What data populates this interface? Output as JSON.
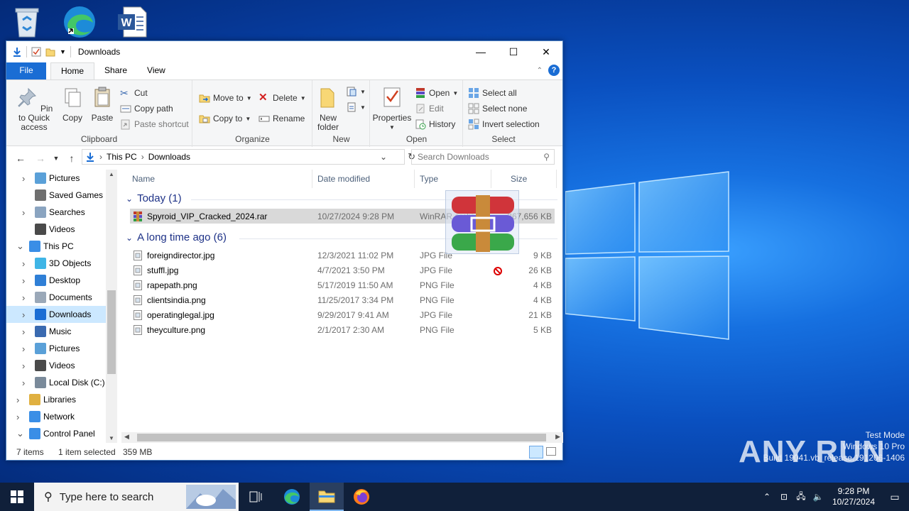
{
  "window": {
    "title": "Downloads",
    "tabs": {
      "file": "File",
      "home": "Home",
      "share": "Share",
      "view": "View"
    }
  },
  "ribbon": {
    "clipboard": {
      "label": "Clipboard",
      "pin": "Pin to Quick access",
      "copy": "Copy",
      "paste": "Paste",
      "cut": "Cut",
      "copy_path": "Copy path",
      "paste_shortcut": "Paste shortcut"
    },
    "organize": {
      "label": "Organize",
      "move_to": "Move to",
      "copy_to": "Copy to",
      "delete": "Delete",
      "rename": "Rename"
    },
    "new": {
      "label": "New",
      "new_folder": "New folder"
    },
    "open": {
      "label": "Open",
      "properties": "Properties",
      "open": "Open",
      "edit": "Edit",
      "history": "History"
    },
    "select": {
      "label": "Select",
      "select_all": "Select all",
      "select_none": "Select none",
      "invert": "Invert selection"
    }
  },
  "address": {
    "crumbs": [
      "This PC",
      "Downloads"
    ],
    "search_placeholder": "Search Downloads"
  },
  "nav": [
    {
      "label": "Pictures",
      "icon": "pictures-icon",
      "level": 1,
      "arrow": ">"
    },
    {
      "label": "Saved Games",
      "icon": "saved-games-icon",
      "level": 1,
      "arrow": ""
    },
    {
      "label": "Searches",
      "icon": "search-folder-icon",
      "level": 1,
      "arrow": ">"
    },
    {
      "label": "Videos",
      "icon": "videos-icon",
      "level": 1,
      "arrow": ""
    },
    {
      "label": "This PC",
      "icon": "this-pc-icon",
      "level": 0,
      "arrow": "v"
    },
    {
      "label": "3D Objects",
      "icon": "3d-objects-icon",
      "level": 1,
      "arrow": ">"
    },
    {
      "label": "Desktop",
      "icon": "desktop-folder-icon",
      "level": 1,
      "arrow": ">"
    },
    {
      "label": "Documents",
      "icon": "documents-icon",
      "level": 1,
      "arrow": ">"
    },
    {
      "label": "Downloads",
      "icon": "downloads-icon",
      "level": 1,
      "arrow": ">",
      "selected": true
    },
    {
      "label": "Music",
      "icon": "music-icon",
      "level": 1,
      "arrow": ">"
    },
    {
      "label": "Pictures",
      "icon": "pictures-icon",
      "level": 1,
      "arrow": ">"
    },
    {
      "label": "Videos",
      "icon": "videos-icon",
      "level": 1,
      "arrow": ">"
    },
    {
      "label": "Local Disk (C:)",
      "icon": "local-disk-icon",
      "level": 1,
      "arrow": ">"
    },
    {
      "label": "Libraries",
      "icon": "libraries-icon",
      "level": 0,
      "arrow": ">"
    },
    {
      "label": "Network",
      "icon": "network-icon",
      "level": 0,
      "arrow": ">"
    },
    {
      "label": "Control Panel",
      "icon": "control-panel-icon",
      "level": 0,
      "arrow": "v"
    }
  ],
  "columns": {
    "name": "Name",
    "date": "Date modified",
    "type": "Type",
    "size": "Size"
  },
  "groups": [
    {
      "title": "Today (1)",
      "files": [
        {
          "name": "Spyroid_VIP_Cracked_2024.rar",
          "date": "10/27/2024 9:28 PM",
          "type": "WinRAR archive",
          "size": "367,656 KB",
          "selected": true
        }
      ]
    },
    {
      "title": "A long time ago (6)",
      "files": [
        {
          "name": "foreigndirector.jpg",
          "date": "12/3/2021 11:02 PM",
          "type": "JPG File",
          "size": "9 KB"
        },
        {
          "name": "stuffl.jpg",
          "date": "4/7/2021 3:50 PM",
          "type": "JPG File",
          "size": "26 KB"
        },
        {
          "name": "rapepath.png",
          "date": "5/17/2019 11:50 AM",
          "type": "PNG File",
          "size": "4 KB"
        },
        {
          "name": "clientsindia.png",
          "date": "11/25/2017 3:34 PM",
          "type": "PNG File",
          "size": "4 KB"
        },
        {
          "name": "operatinglegal.jpg",
          "date": "9/29/2017 9:41 AM",
          "type": "JPG File",
          "size": "21 KB"
        },
        {
          "name": "theyculture.png",
          "date": "2/1/2017 2:30 AM",
          "type": "PNG File",
          "size": "5 KB"
        }
      ]
    }
  ],
  "status": {
    "items": "7 items",
    "selected": "1 item selected",
    "size": "359 MB"
  },
  "taskbar": {
    "search_placeholder": "Type here to search",
    "time": "9:28 PM",
    "date": "10/27/2024"
  },
  "watermark": {
    "mode": "Test Mode",
    "edition": "Windows 10 Pro",
    "build": "Build 19041.vb_release.191206-1406",
    "brand": "ANY RUN"
  }
}
